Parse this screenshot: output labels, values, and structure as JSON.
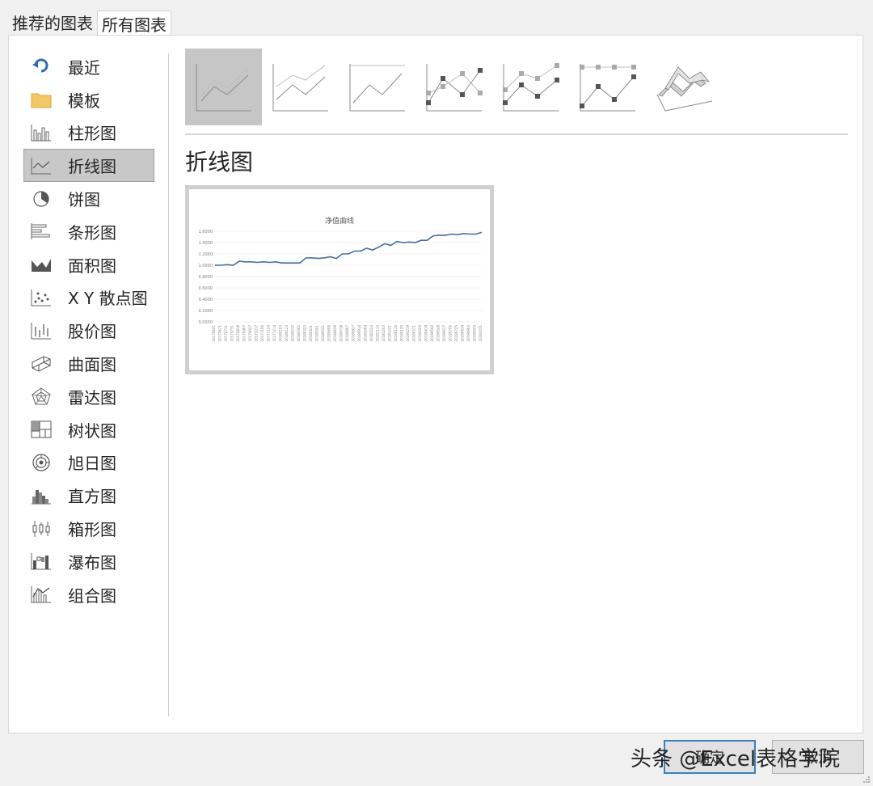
{
  "tabs": [
    {
      "label": "推荐的图表"
    },
    {
      "label": "所有图表"
    }
  ],
  "sidebar": {
    "items": [
      {
        "label": "最近",
        "icon": "recent-icon"
      },
      {
        "label": "模板",
        "icon": "folder-icon"
      },
      {
        "label": "柱形图",
        "icon": "column-chart-icon"
      },
      {
        "label": "折线图",
        "icon": "line-chart-icon",
        "selected": true
      },
      {
        "label": "饼图",
        "icon": "pie-chart-icon"
      },
      {
        "label": "条形图",
        "icon": "bar-chart-icon"
      },
      {
        "label": "面积图",
        "icon": "area-chart-icon"
      },
      {
        "label": "X Y 散点图",
        "icon": "scatter-chart-icon"
      },
      {
        "label": "股价图",
        "icon": "stock-chart-icon"
      },
      {
        "label": "曲面图",
        "icon": "surface-chart-icon"
      },
      {
        "label": "雷达图",
        "icon": "radar-chart-icon"
      },
      {
        "label": "树状图",
        "icon": "treemap-chart-icon"
      },
      {
        "label": "旭日图",
        "icon": "sunburst-chart-icon"
      },
      {
        "label": "直方图",
        "icon": "histogram-chart-icon"
      },
      {
        "label": "箱形图",
        "icon": "box-whisker-chart-icon"
      },
      {
        "label": "瀑布图",
        "icon": "waterfall-chart-icon"
      },
      {
        "label": "组合图",
        "icon": "combo-chart-icon"
      }
    ]
  },
  "subtypes": [
    {
      "icon": "line-subtype-icon",
      "selected": true
    },
    {
      "icon": "stacked-line-subtype-icon"
    },
    {
      "icon": "100-stacked-line-subtype-icon"
    },
    {
      "icon": "line-with-markers-subtype-icon"
    },
    {
      "icon": "stacked-line-with-markers-subtype-icon"
    },
    {
      "icon": "100-stacked-line-with-markers-subtype-icon"
    },
    {
      "icon": "3d-line-subtype-icon"
    }
  ],
  "main": {
    "type_title": "折线图"
  },
  "preview": {
    "chart_data": {
      "type": "line",
      "title": "净值曲线",
      "ylim": [
        0,
        1.6
      ],
      "yticks": [
        "1.6000",
        "1.4000",
        "1.2000",
        "1.0000",
        "0.8000",
        "0.6000",
        "0.4000",
        "0.2000",
        "0.0000"
      ],
      "x": [
        "20170601",
        "20170621",
        "20170711",
        "20170731",
        "20170818",
        "20170907",
        "20170927",
        "20171017",
        "20171106",
        "20171124",
        "20171214",
        "20180103",
        "20180123",
        "20180212",
        "20180302",
        "20180322",
        "20180411",
        "20180501",
        "20180521",
        "20180608",
        "20180628",
        "20180718",
        "20180807",
        "20180827",
        "20180914",
        "20181004",
        "20181024",
        "20181113",
        "20181203",
        "20181221",
        "20190110",
        "20190130",
        "20190219",
        "20190311",
        "20190329",
        "20190418",
        "20190508",
        "20190528",
        "20190617",
        "20190705",
        "20190725",
        "20190814",
        "20190903",
        "20190923",
        "20191011"
      ],
      "series": [
        {
          "values": [
            1.0,
            1.0,
            1.01,
            1.0,
            1.07,
            1.06,
            1.06,
            1.05,
            1.06,
            1.05,
            1.06,
            1.04,
            1.04,
            1.04,
            1.04,
            1.13,
            1.13,
            1.12,
            1.13,
            1.15,
            1.12,
            1.2,
            1.2,
            1.25,
            1.25,
            1.3,
            1.27,
            1.32,
            1.38,
            1.35,
            1.42,
            1.4,
            1.41,
            1.4,
            1.44,
            1.44,
            1.52,
            1.53,
            1.53,
            1.55,
            1.54,
            1.56,
            1.55,
            1.55,
            1.58
          ]
        }
      ],
      "line_color": "#4a6c9b",
      "grid": true
    }
  },
  "buttons": {
    "ok": "确定",
    "cancel": "取消"
  },
  "watermark": "头条 @Excel表格学院"
}
